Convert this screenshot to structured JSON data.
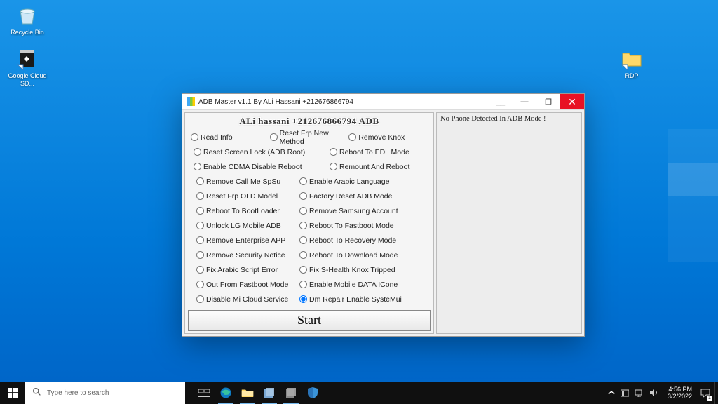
{
  "desktop": {
    "icons": [
      {
        "label": "Recycle Bin"
      },
      {
        "label": "Google Cloud SD..."
      },
      {
        "label": "RDP"
      }
    ]
  },
  "window": {
    "title": "ADB Master v1.1 By ALi Hassani +212676866794",
    "banner": "ALi hassani +212676866794 ADB",
    "start_label": "Start",
    "log_text": "No Phone Detected In ADB Mode !",
    "radios": {
      "r1": "Read Info",
      "r2": "Reset Frp New Method",
      "r3": "Remove Knox",
      "r4": "Reset Screen Lock (ADB Root)",
      "r5": "Reboot To EDL Mode",
      "r6": "Enable CDMA  Disable Reboot",
      "r7": "Remount And Reboot",
      "r8": "Remove Call Me SpSu",
      "r9": "Enable Arabic Language",
      "r10": "Reset Frp OLD Model",
      "r11": "Factory Reset ADB Mode",
      "r12": "Reboot To BootLoader",
      "r13": "Remove Samsung Account",
      "r14": "Unlock LG Mobile ADB",
      "r15": "Reboot To Fastboot Mode",
      "r16": "Remove Enterprise APP",
      "r17": "Reboot To Recovery Mode",
      "r18": "Remove Security Notice",
      "r19": "Reboot To Download Mode",
      "r20": "Fix Arabic Script Error",
      "r21": "Fix S-Health Knox Tripped",
      "r22": "Out From Fastboot Mode",
      "r23": "Enable Mobile DATA ICone",
      "r24": "Disable Mi Cloud Service",
      "r25": "Dm Repair Enable SysteMui"
    },
    "selected": "r25"
  },
  "taskbar": {
    "search_placeholder": "Type here to search",
    "time": "4:56 PM",
    "date": "3/2/2022",
    "notification_count": "1"
  }
}
